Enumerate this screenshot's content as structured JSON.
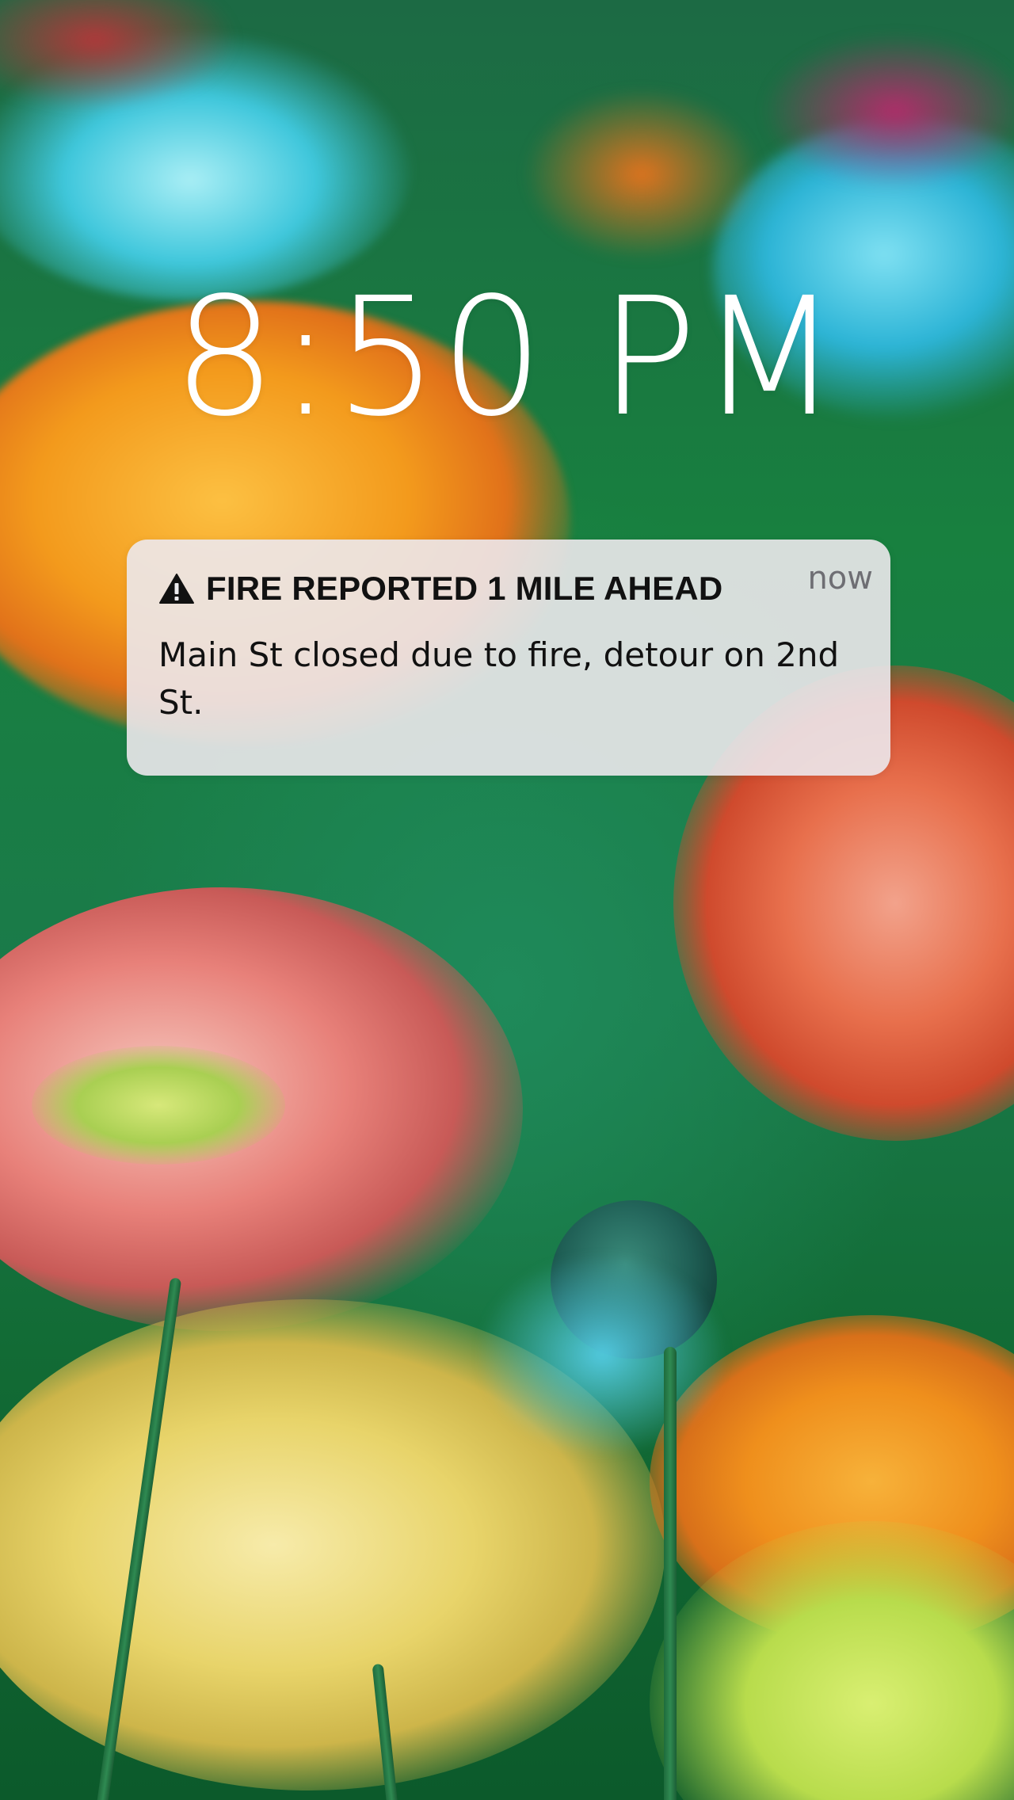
{
  "lockscreen": {
    "time": "8:50 PM"
  },
  "notification": {
    "icon": "warning-triangle-icon",
    "title": "FIRE REPORTED 1 MILE AHEAD",
    "timestamp": "now",
    "body": "Main St closed due to fire, detour on 2nd St."
  },
  "wallpaper": {
    "description_colors": {
      "teal": "#2fb8d6",
      "orange": "#f39a1c",
      "pink": "#e8817a",
      "red_orange": "#e4663e",
      "yellow": "#e8d46a",
      "green": "#1a7a4a"
    }
  }
}
